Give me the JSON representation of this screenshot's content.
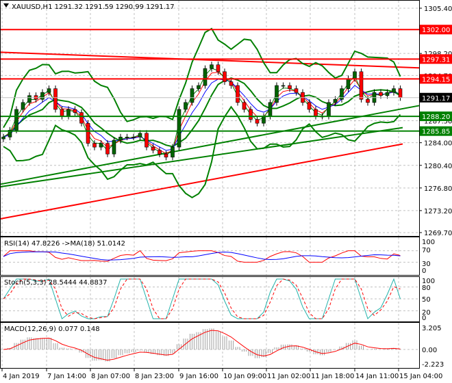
{
  "chart_data": {
    "type": "candlestick",
    "symbol_label": "XAUUSD,H1",
    "ohlc_label": [
      "1291.32",
      "1291.59",
      "1290.99",
      "1291.17"
    ],
    "closes": [
      1284.9,
      1286.0,
      1289.3,
      1290.4,
      1291.5,
      1290.9,
      1292.0,
      1292.6,
      1289.3,
      1288.2,
      1289.3,
      1288.8,
      1287.1,
      1283.9,
      1283.3,
      1283.9,
      1282.2,
      1284.4,
      1284.9,
      1284.9,
      1284.9,
      1285.5,
      1283.3,
      1282.8,
      1282.2,
      1281.7,
      1283.3,
      1289.3,
      1290.4,
      1292.6,
      1293.1,
      1295.8,
      1296.4,
      1295.3,
      1293.7,
      1293.1,
      1290.4,
      1289.3,
      1287.7,
      1287.1,
      1288.2,
      1290.4,
      1293.1,
      1293.1,
      1292.6,
      1292.0,
      1290.4,
      1289.3,
      1288.2,
      1288.2,
      1290.4,
      1290.9,
      1292.6,
      1294.2,
      1295.3,
      1290.9,
      1290.4,
      1292.0,
      1291.5,
      1292.0,
      1292.6,
      1291.17
    ],
    "ylim": [
      1269.7,
      1305.4
    ],
    "y_ticks": [
      "1305.40",
      "1298.20",
      "1294.70",
      "1287.50",
      "1284.00",
      "1280.40",
      "1276.80",
      "1273.20",
      "1269.70"
    ],
    "x_ticks": [
      "4 Jan 2019",
      "7 Jan 14:00",
      "8 Jan 07:00",
      "8 Jan 23:00",
      "9 Jan 16:00",
      "10 Jan 09:00",
      "11 Jan 02:00",
      "11 Jan 18:00",
      "14 Jan 11:00",
      "15 Jan 04:00"
    ],
    "levels": [
      {
        "price": 1302.0,
        "label": "1302.00",
        "color": "#ff0000"
      },
      {
        "price": 1297.31,
        "label": "1297.31",
        "color": "#ff0000"
      },
      {
        "price": 1294.15,
        "label": "1294.15",
        "color": "#ff0000"
      },
      {
        "price": 1291.17,
        "label": "1291.17",
        "color": "#000000"
      },
      {
        "price": 1288.2,
        "label": "1288.20",
        "color": "#008000"
      },
      {
        "price": 1285.85,
        "label": "1285.85",
        "color": "#008000"
      }
    ],
    "trendlines": [
      {
        "from": 1298.4,
        "to": 1295.9,
        "color": "#ff0000"
      },
      {
        "from": 1277.4,
        "to": 1289.9,
        "color": "#008000"
      },
      {
        "from": 1277.0,
        "to": 1286.4,
        "color": "#008000"
      },
      {
        "from": 1271.9,
        "to": 1283.8,
        "color": "#ff0000"
      }
    ],
    "colors": {
      "bull": "#006400",
      "bear": "#ff0000",
      "band": "#008000",
      "ma_fast": "#ff0000",
      "ma_mid": "#0000ff",
      "ma_slow": "#008000"
    },
    "rsi": {
      "label": "RSI(14) 47.8226  ->MA(18) 51.0142",
      "ticks": [
        "100",
        "70",
        "30",
        "0"
      ]
    },
    "stoch": {
      "label": "Stoch(5,3,3) 28.5444 44.8837",
      "ticks": [
        "100",
        "80",
        "50",
        "20",
        "0"
      ]
    },
    "macd": {
      "label": "MACD(12,26,9) 0.077 0.148",
      "ticks": [
        "3.205",
        "0.00",
        "-2.223"
      ]
    }
  }
}
